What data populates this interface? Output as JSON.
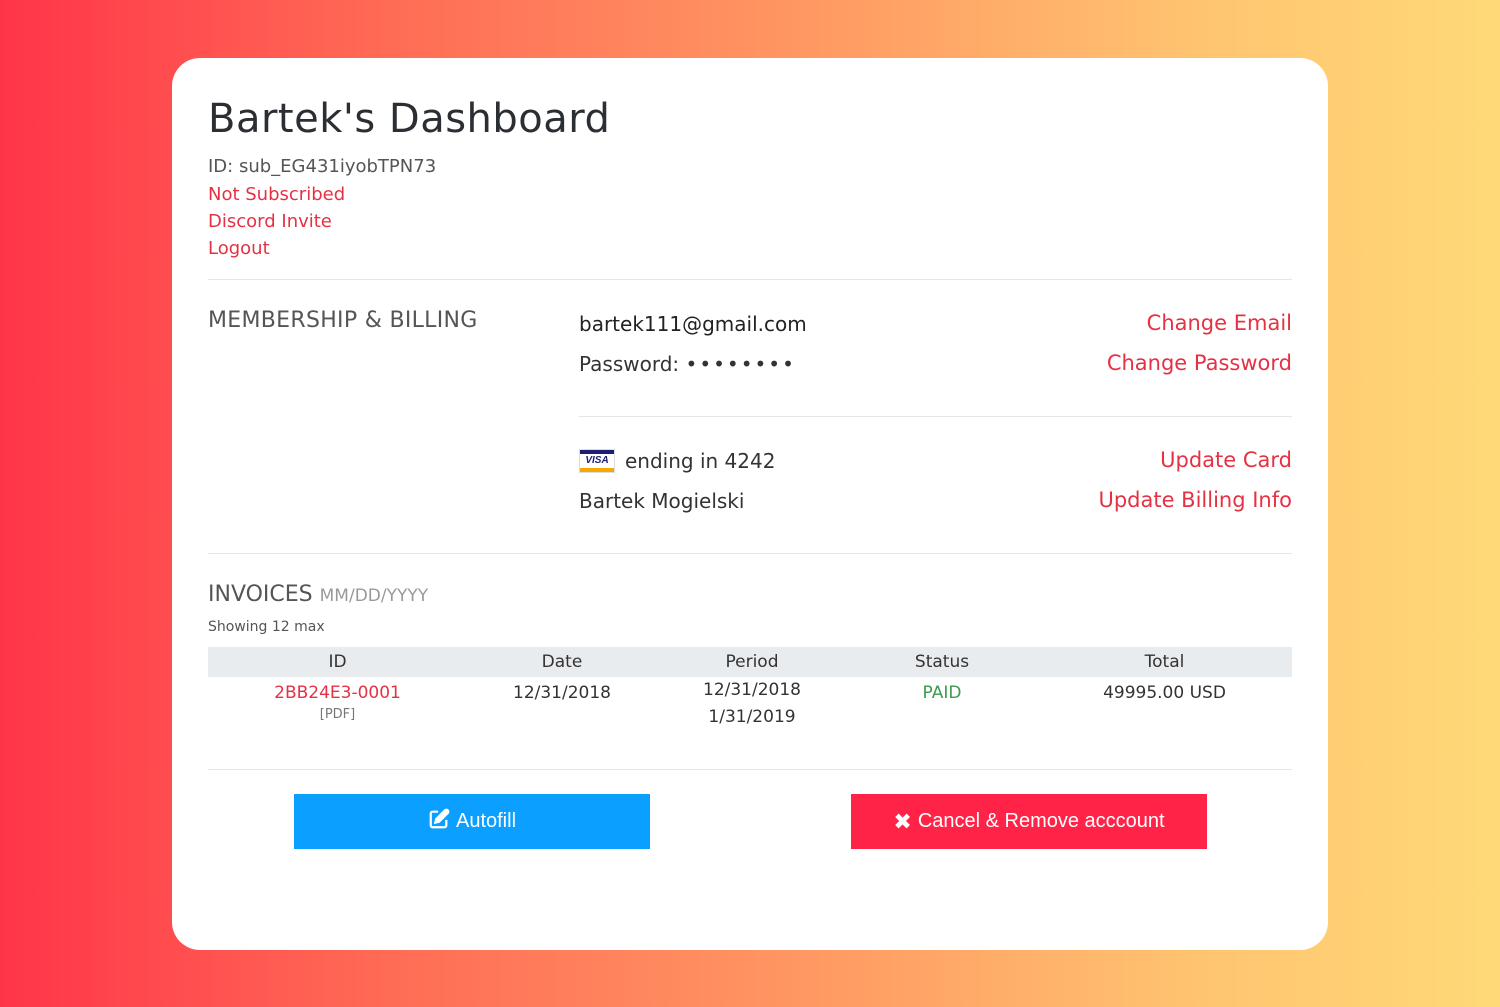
{
  "header": {
    "title": "Bartek's Dashboard",
    "id_line": "ID: sub_EG431iyobTPN73",
    "subscription_status": "Not Subscribed",
    "discord_link": "Discord Invite",
    "logout_link": "Logout"
  },
  "membership": {
    "section_title": "MEMBERSHIP & BILLING",
    "email": "bartek111@gmail.com",
    "password_label": "Password:",
    "password_mask": "••••••••",
    "change_email": "Change Email",
    "change_password": "Change Password",
    "card_brand": "VISA",
    "card_text": "ending in 4242",
    "billing_name": "Bartek Mogielski",
    "update_card": "Update Card",
    "update_billing": "Update Billing Info"
  },
  "invoices": {
    "title": "INVOICES",
    "date_format": "MM/DD/YYYY",
    "note": "Showing 12 max",
    "columns": [
      "ID",
      "Date",
      "Period",
      "Status",
      "Total"
    ],
    "rows": [
      {
        "id": "2BB24E3-0001",
        "pdf": "[PDF]",
        "date": "12/31/2018",
        "period_start": "12/31/2018",
        "period_end": "1/31/2019",
        "status": "PAID",
        "total": "49995.00 USD"
      }
    ]
  },
  "actions": {
    "autofill": "Autofill",
    "cancel": "Cancel & Remove acccount"
  },
  "colors": {
    "accent_link": "#e53144",
    "paid": "#3a9b4c",
    "autofill_button": "#0ba0ff",
    "cancel_button": "#ff2447"
  }
}
